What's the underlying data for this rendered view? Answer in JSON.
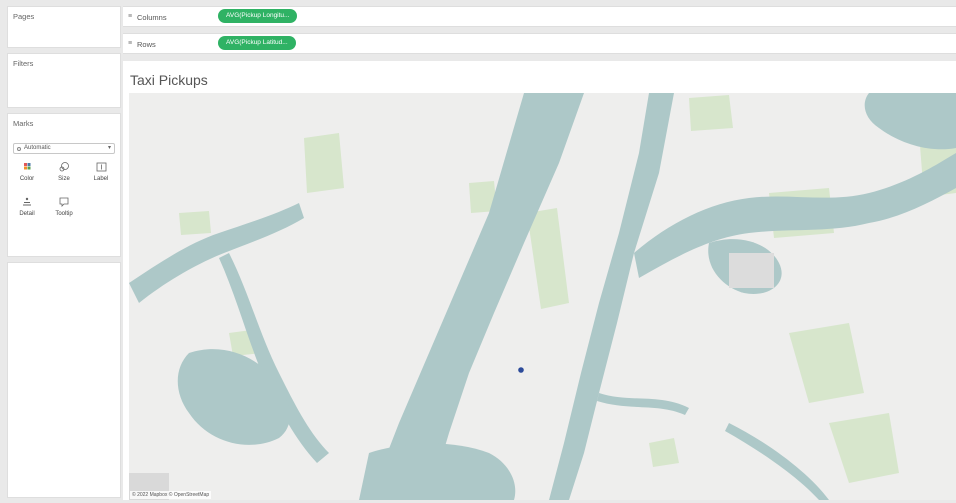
{
  "cards": {
    "pages": "Pages",
    "filters": "Filters",
    "marks": "Marks"
  },
  "marks": {
    "mark_type": "Automatic",
    "buttons": [
      "Color",
      "Size",
      "Label",
      "Detail",
      "Tooltip"
    ]
  },
  "shelves": {
    "columns_label": "Columns",
    "columns_pill": "AVG(Pickup Longitu...",
    "rows_label": "Rows",
    "rows_pill": "AVG(Pickup Latitud..."
  },
  "view": {
    "title": "Taxi Pickups",
    "attribution": "© 2022 Mapbox © OpenStreetMap"
  },
  "colors": {
    "water": "#adc8c8",
    "land": "#eeeeed",
    "park": "#d7e6cc",
    "pill": "#2fb264",
    "mark": "#2c4b9a"
  }
}
